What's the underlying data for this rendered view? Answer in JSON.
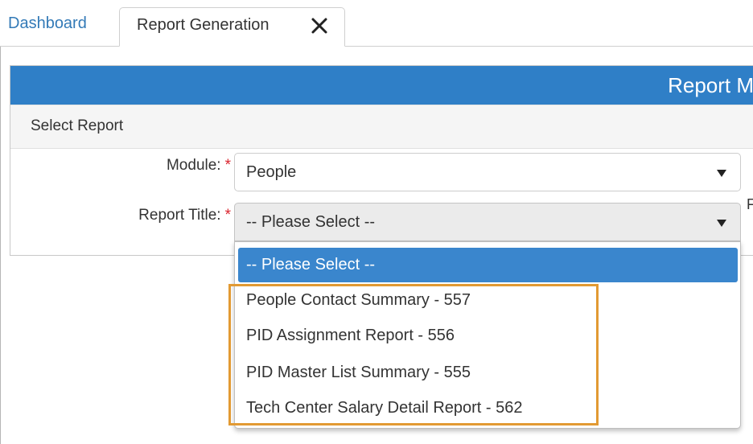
{
  "tabs": {
    "dashboard_label": "Dashboard",
    "active_label": "Report Generation"
  },
  "panel": {
    "title": "Report M",
    "section_label": "Select Report"
  },
  "form": {
    "module_label": "Module:",
    "report_title_label": "Report Title:",
    "required_marker": "*",
    "module_value": "People",
    "report_title_value": "-- Please Select --",
    "partial_right_glyph": "F"
  },
  "dropdown": {
    "selected_option": "-- Please Select --",
    "options": [
      "People Contact Summary - 557",
      "PID Assignment Report - 556",
      "PID Master List Summary - 555",
      "Tech Center Salary Detail Report - 562"
    ]
  },
  "colors": {
    "accent_blue": "#2f7fc7",
    "link_blue": "#337ab7",
    "required_red": "#d9232d",
    "highlight_orange": "#e29a33"
  }
}
